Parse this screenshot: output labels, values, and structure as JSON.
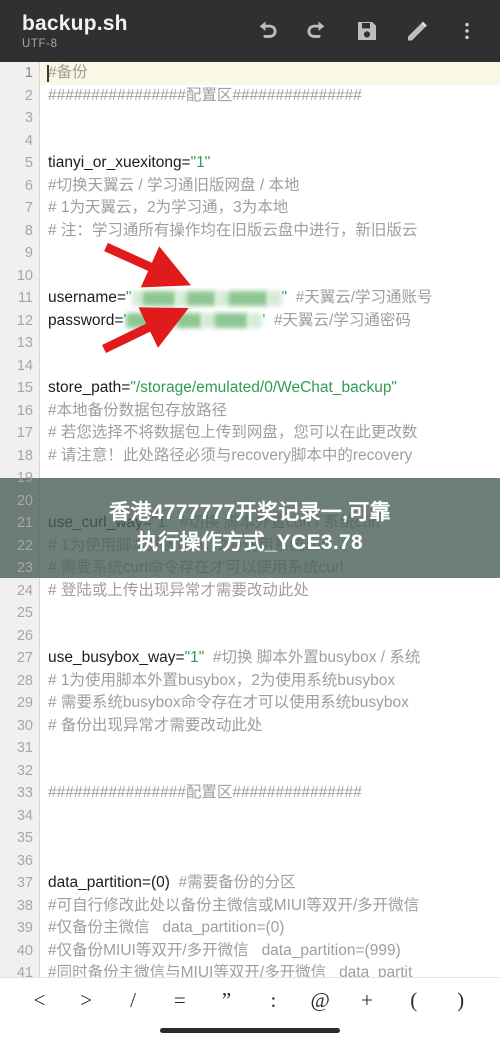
{
  "appbar": {
    "file_title": "backup.sh",
    "encoding": "UTF-8",
    "actions": [
      {
        "name": "undo-button",
        "label": "Undo"
      },
      {
        "name": "redo-button",
        "label": "Redo"
      },
      {
        "name": "save-button",
        "label": "Save"
      },
      {
        "name": "edit-button",
        "label": "Edit"
      },
      {
        "name": "more-options-button",
        "label": "More options"
      }
    ]
  },
  "editor": {
    "cursor_line": 1,
    "lines": [
      {
        "n": "1",
        "parts": [
          {
            "t": "#备份",
            "k": "comment"
          }
        ]
      },
      {
        "n": "2",
        "parts": [
          {
            "t": "################配置区###############",
            "k": "comment"
          }
        ]
      },
      {
        "n": "3",
        "parts": []
      },
      {
        "n": "4",
        "parts": []
      },
      {
        "n": "5",
        "parts": [
          {
            "t": "tianyi_or_xuexitong=",
            "k": "code"
          },
          {
            "t": "\"1\"",
            "k": "str"
          }
        ]
      },
      {
        "n": "6",
        "parts": [
          {
            "t": "#切换天翼云 / 学习通旧版网盘 / 本地",
            "k": "comment"
          }
        ]
      },
      {
        "n": "7",
        "parts": [
          {
            "t": "# 1为天翼云，2为学习通，3为本地",
            "k": "comment"
          }
        ]
      },
      {
        "n": "8",
        "parts": [
          {
            "t": "# 注：学习通所有操作均在旧版云盘中进行，新旧版云",
            "k": "comment"
          }
        ]
      },
      {
        "n": "9",
        "parts": []
      },
      {
        "n": "10",
        "parts": []
      },
      {
        "n": "11",
        "parts": [
          {
            "t": "username=",
            "k": "code"
          },
          {
            "t": "\"",
            "k": "str"
          },
          {
            "t": "",
            "k": "redact-user"
          },
          {
            "t": "\"",
            "k": "str"
          },
          {
            "t": "  #天翼云/学习通账号",
            "k": "comment"
          }
        ]
      },
      {
        "n": "12",
        "parts": [
          {
            "t": "password=",
            "k": "code"
          },
          {
            "t": "'",
            "k": "str"
          },
          {
            "t": "",
            "k": "redact-pass"
          },
          {
            "t": "'",
            "k": "str"
          },
          {
            "t": "  #天翼云/学习通密码",
            "k": "comment"
          }
        ]
      },
      {
        "n": "13",
        "parts": []
      },
      {
        "n": "14",
        "parts": []
      },
      {
        "n": "15",
        "parts": [
          {
            "t": "store_path=",
            "k": "code"
          },
          {
            "t": "\"/storage/emulated/0/WeChat_backup\"",
            "k": "str"
          }
        ]
      },
      {
        "n": "16",
        "parts": [
          {
            "t": "#本地备份数据包存放路径",
            "k": "comment"
          }
        ]
      },
      {
        "n": "17",
        "parts": [
          {
            "t": "# 若您选择不将数据包上传到网盘，您可以在此更改数",
            "k": "comment"
          }
        ]
      },
      {
        "n": "18",
        "parts": [
          {
            "t": "# 请注意！此处路径必须与recovery脚本中的recovery",
            "k": "comment"
          }
        ]
      },
      {
        "n": "19",
        "parts": []
      },
      {
        "n": "20",
        "parts": []
      },
      {
        "n": "21",
        "parts": [
          {
            "t": "use_curl_way=",
            "k": "code"
          },
          {
            "t": "\"1\"",
            "k": "str"
          },
          {
            "t": "  #切换 脚本外置curl / 系统curl",
            "k": "comment"
          }
        ]
      },
      {
        "n": "22",
        "parts": [
          {
            "t": "# 1为使用脚本外置curl，2为使用系统curl",
            "k": "comment"
          }
        ]
      },
      {
        "n": "23",
        "parts": [
          {
            "t": "# 需要系统curl命令存在才可以使用系统curl",
            "k": "comment"
          }
        ]
      },
      {
        "n": "24",
        "parts": [
          {
            "t": "# 登陆或上传出现异常才需要改动此处",
            "k": "comment"
          }
        ]
      },
      {
        "n": "25",
        "parts": []
      },
      {
        "n": "26",
        "parts": []
      },
      {
        "n": "27",
        "parts": [
          {
            "t": "use_busybox_way=",
            "k": "code"
          },
          {
            "t": "\"1\"",
            "k": "str"
          },
          {
            "t": "  #切换 脚本外置busybox / 系统",
            "k": "comment"
          }
        ]
      },
      {
        "n": "28",
        "parts": [
          {
            "t": "# 1为使用脚本外置busybox，2为使用系统busybox",
            "k": "comment"
          }
        ]
      },
      {
        "n": "29",
        "parts": [
          {
            "t": "# 需要系统busybox命令存在才可以使用系统busybox",
            "k": "comment"
          }
        ]
      },
      {
        "n": "30",
        "parts": [
          {
            "t": "# 备份出现异常才需要改动此处",
            "k": "comment"
          }
        ]
      },
      {
        "n": "31",
        "parts": []
      },
      {
        "n": "32",
        "parts": []
      },
      {
        "n": "33",
        "parts": [
          {
            "t": "################配置区###############",
            "k": "comment"
          }
        ]
      },
      {
        "n": "34",
        "parts": []
      },
      {
        "n": "35",
        "parts": []
      },
      {
        "n": "36",
        "parts": []
      },
      {
        "n": "37",
        "parts": [
          {
            "t": "data_partition=(0)",
            "k": "code"
          },
          {
            "t": "  #需要备份的分区",
            "k": "comment"
          }
        ]
      },
      {
        "n": "38",
        "parts": [
          {
            "t": "#可自行修改此处以备份主微信或MIUI等双开/多开微信",
            "k": "comment"
          }
        ]
      },
      {
        "n": "39",
        "parts": [
          {
            "t": "#仅备份主微信   data_partition=(0)",
            "k": "comment"
          }
        ]
      },
      {
        "n": "40",
        "parts": [
          {
            "t": "#仅备份MIUI等双开/多开微信   data_partition=(999)",
            "k": "comment"
          }
        ]
      },
      {
        "n": "41",
        "parts": [
          {
            "t": "#同时备份主微信与MIUI等双开/多开微信   data_partit",
            "k": "comment"
          }
        ]
      }
    ]
  },
  "watermark": {
    "line1": "香港4777777开奖记录一,可靠",
    "line2": "执行操作方式_YCE3.78",
    "overlay_color": "#4a5f55"
  },
  "annotations": {
    "arrow_color": "#e11b1b",
    "arrows": [
      {
        "name": "arrow-to-username",
        "direction": "down-right"
      },
      {
        "name": "arrow-to-password",
        "direction": "up-right"
      }
    ]
  },
  "symbol_bar": {
    "keys": [
      "<",
      ">",
      "/",
      "=",
      "”",
      ":",
      "@",
      "+",
      "(",
      ")"
    ]
  }
}
